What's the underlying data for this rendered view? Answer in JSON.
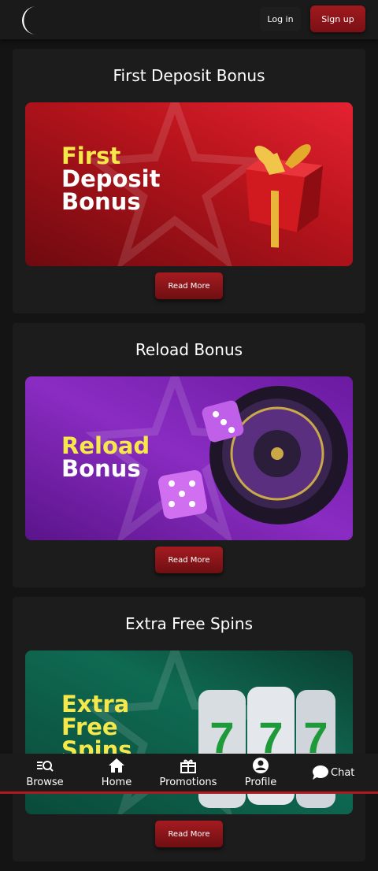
{
  "header": {
    "login_label": "Log in",
    "signup_label": "Sign up"
  },
  "promotions": [
    {
      "title": "First Deposit Bonus",
      "banner_line1": "First",
      "banner_line2": "Deposit",
      "banner_line3": "Bonus",
      "button_label": "Read More"
    },
    {
      "title": "Reload Bonus",
      "banner_line1": "Reload",
      "banner_line2": "Bonus",
      "button_label": "Read More"
    },
    {
      "title": "Extra Free Spins",
      "banner_line1": "Extra",
      "banner_line2": "Free",
      "banner_line3": "Spins",
      "button_label": "Read More"
    }
  ],
  "bottom_nav": {
    "browse": "Browse",
    "home": "Home",
    "promotions": "Promotions",
    "profile": "Profile",
    "chat": "Chat"
  },
  "colors": {
    "accent": "#a01a1f",
    "background": "#141414",
    "card": "#1c1c1c",
    "highlight_text": "#f6e84a"
  },
  "icons": [
    "logo-crescent-icon",
    "gift-icon",
    "dice-icon",
    "roulette-icon",
    "slot-reels-icon",
    "browse-search-icon",
    "home-icon",
    "gift-box-icon",
    "profile-icon",
    "chat-bubble-icon"
  ]
}
